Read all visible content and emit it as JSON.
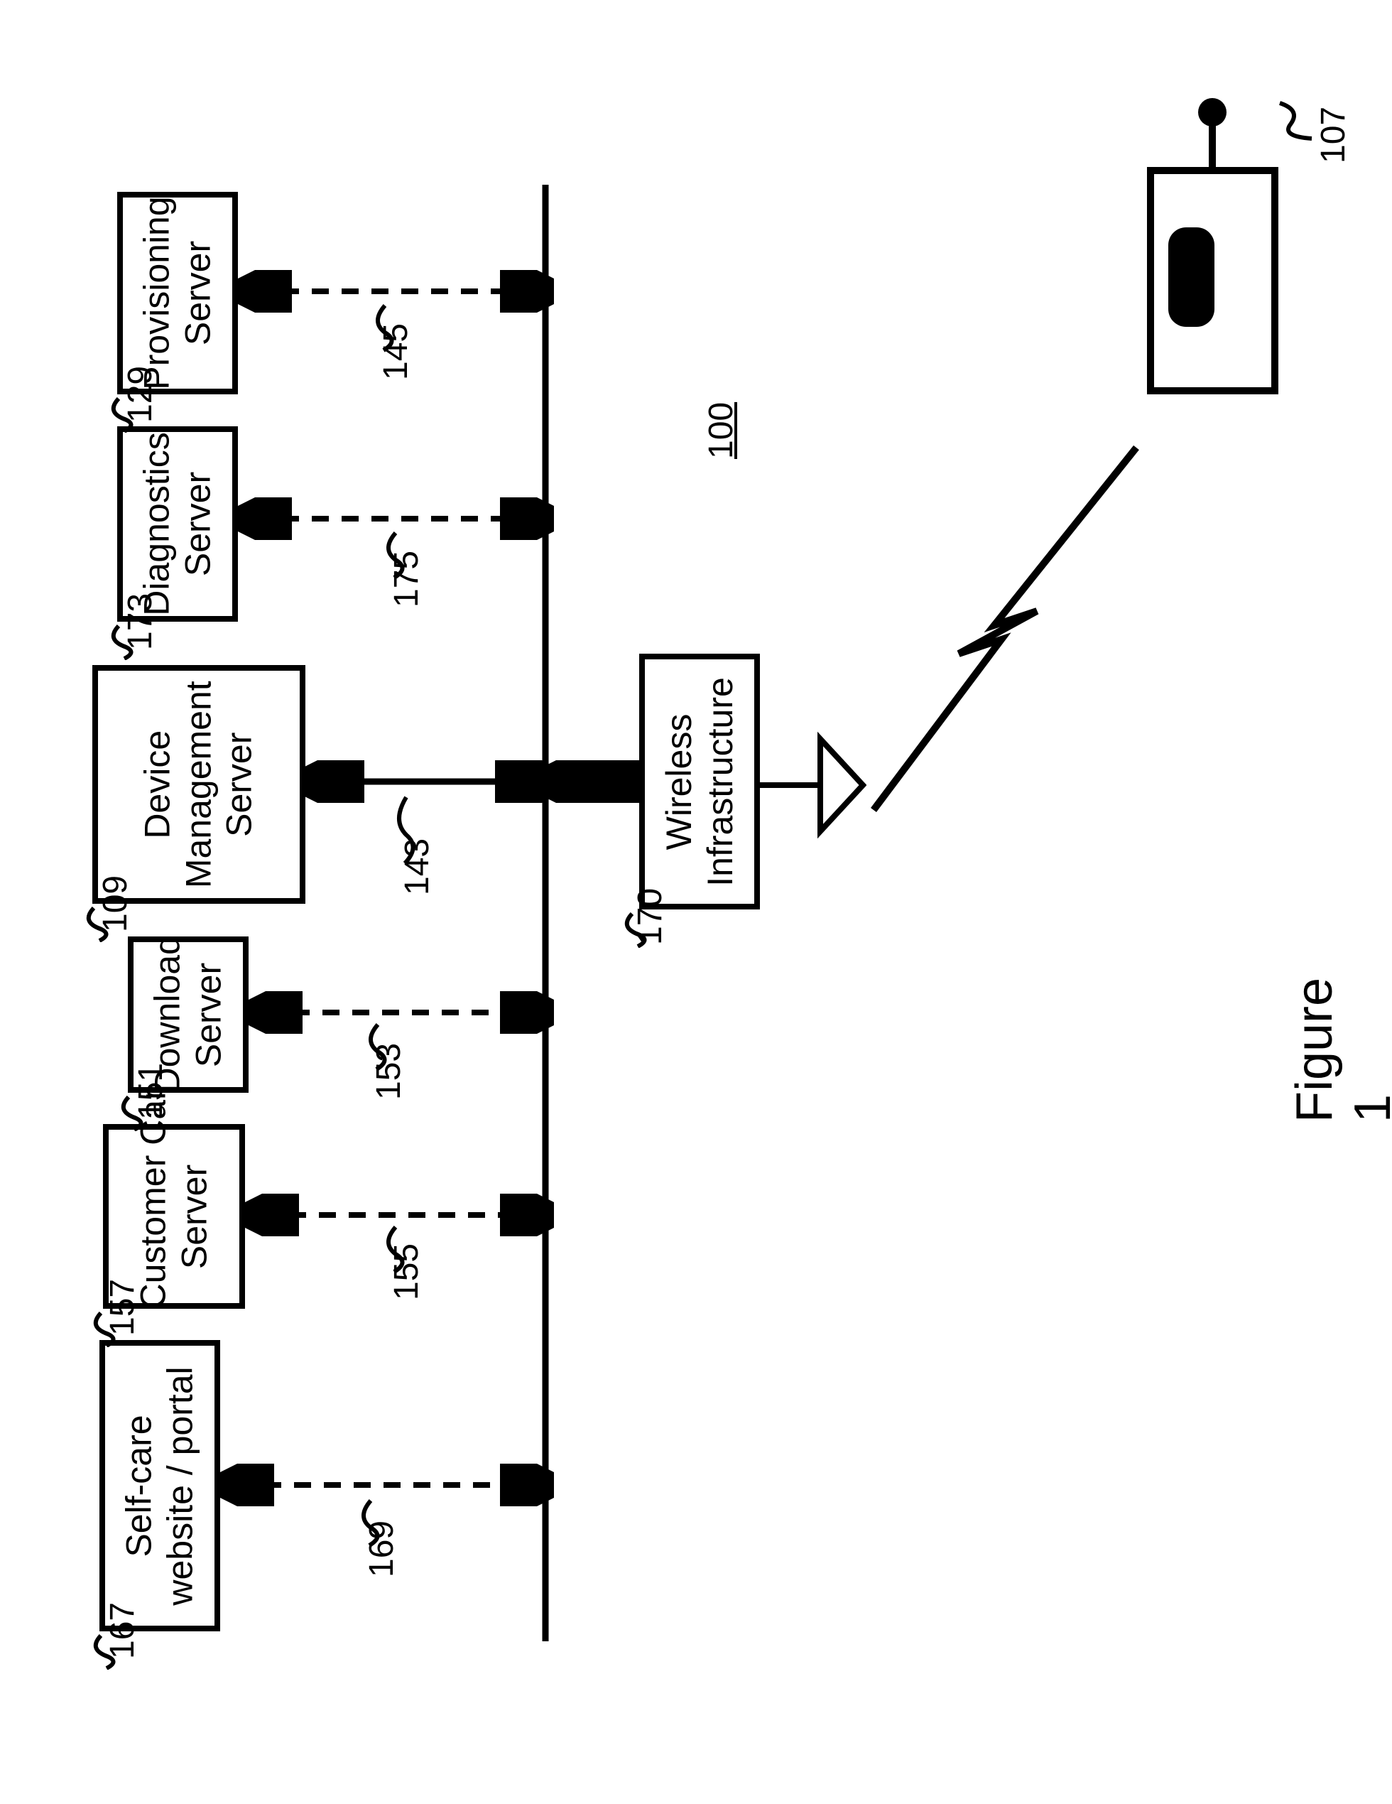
{
  "figure_label": "Figure 1",
  "system_ref": "100",
  "wireless": {
    "label": "Wireless\nInfrastructure",
    "ref": "170"
  },
  "device_ref": "107",
  "servers": [
    {
      "id": "selfcare",
      "label": "Self-care\nwebsite / portal",
      "box_ref": "167",
      "link_ref": "169"
    },
    {
      "id": "custcare",
      "label": "Customer Care\nServer",
      "box_ref": "157",
      "link_ref": "155"
    },
    {
      "id": "download",
      "label": "Download\nServer",
      "box_ref": "151",
      "link_ref": "153"
    },
    {
      "id": "devmgmt",
      "label": "Device\nManagement\nServer",
      "box_ref": "109",
      "link_ref": "143"
    },
    {
      "id": "diag",
      "label": "Diagnostics\nServer",
      "box_ref": "173",
      "link_ref": "175"
    },
    {
      "id": "prov",
      "label": "Provisioning\nServer",
      "box_ref": "129",
      "link_ref": "145"
    }
  ]
}
